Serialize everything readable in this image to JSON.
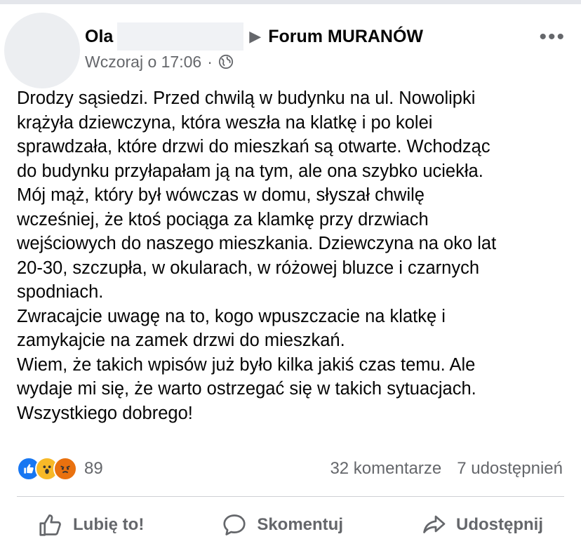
{
  "post": {
    "author": "Ola",
    "group": "Forum MURANÓW",
    "timestamp": "Wczoraj o 17:06",
    "separator": "·",
    "privacy_icon": "globe-icon",
    "more_label": "•••",
    "lines": [
      "Drodzy sąsiedzi. Przed chwilą w budynku na ul. Nowolipki",
      "krążyła dziewczyna, która weszła na klatkę i po kolei",
      "sprawdzała, które drzwi do mieszkań są otwarte. Wchodząc",
      "do budynku przyłapałam ją na tym, ale ona szybko uciekła.",
      "Mój mąż, który był wówczas w domu, słyszał chwilę",
      "wcześniej, że ktoś pociąga za klamkę przy drzwiach",
      "wejściowych do naszego mieszkania. Dziewczyna na oko lat",
      "20-30, szczupła, w okularach, w różowej bluzce i czarnych",
      "spodniach.",
      "Zwracajcie uwagę na to, kogo wpuszczacie na klatkę i",
      "zamykajcie na zamek drzwi do mieszkań.",
      "Wiem, że takich wpisów już było kilka jakiś czas temu. Ale",
      "wydaje mi się, że warto ostrzegać się w takich sytuacjach.",
      "Wszystkiego dobrego!"
    ]
  },
  "engagement": {
    "reaction_icons": [
      "like-icon",
      "wow-icon",
      "angry-icon"
    ],
    "reaction_count": "89",
    "comments": "32 komentarze",
    "shares": "7 udostępnień"
  },
  "actions": {
    "like": "Lubię to!",
    "comment": "Skomentuj",
    "share": "Udostępnij"
  },
  "colors": {
    "text": "#050505",
    "secondary": "#65676b",
    "like_blue": "#1877f2",
    "wow_yellow": "#f7b928",
    "angry_orange": "#e9710f"
  }
}
